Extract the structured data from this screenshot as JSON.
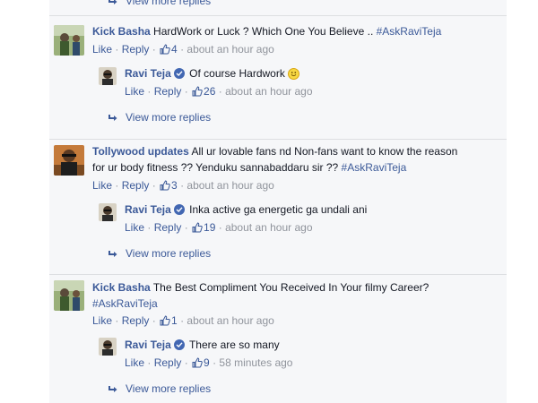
{
  "top": {
    "more_label": "View more replies"
  },
  "threads": [
    {
      "author": "Kick Basha",
      "text": "HardWork or Luck ? Which One You Believe ..",
      "hashtag": "#AskRaviTeja",
      "like": "Like",
      "reply": "Reply",
      "likes": "4",
      "time": "about an hour ago",
      "avatar_icon": "movie-poster-avatar",
      "reply_item": {
        "author": "Ravi Teja",
        "text": "Of course Hardwork",
        "emoji": "smiley-emoji",
        "like": "Like",
        "reply": "Reply",
        "likes": "26",
        "time": "about an hour ago"
      },
      "more_label": "View more replies"
    },
    {
      "author": "Tollywood updates",
      "text_line1": "All ur lovable fans nd Non-fans want to know the reason",
      "text_line2": "for ur body fitness ?? Yenduku sannabaddaru sir ??",
      "hashtag": "#AskRaviTeja",
      "like": "Like",
      "reply": "Reply",
      "likes": "3",
      "time": "about an hour ago",
      "avatar_icon": "film-star-avatar",
      "reply_item": {
        "author": "Ravi Teja",
        "text": "Inka active ga energetic ga undali ani",
        "like": "Like",
        "reply": "Reply",
        "likes": "19",
        "time": "about an hour ago"
      },
      "more_label": "View more replies"
    },
    {
      "author": "Kick Basha",
      "text": "The Best Compliment You Received In Your filmy Career?",
      "hashtag": "#AskRaviTeja",
      "like": "Like",
      "reply": "Reply",
      "likes": "1",
      "time": "about an hour ago",
      "avatar_icon": "movie-poster-avatar",
      "reply_item": {
        "author": "Ravi Teja",
        "text": "There are so many",
        "like": "Like",
        "reply": "Reply",
        "likes": "9",
        "time": "58 minutes ago"
      },
      "more_label": "View more replies"
    }
  ],
  "colors": {
    "link": "#3b5998",
    "meta": "#90949c",
    "background": "#f6f7f9",
    "verified": "#4267b2"
  }
}
